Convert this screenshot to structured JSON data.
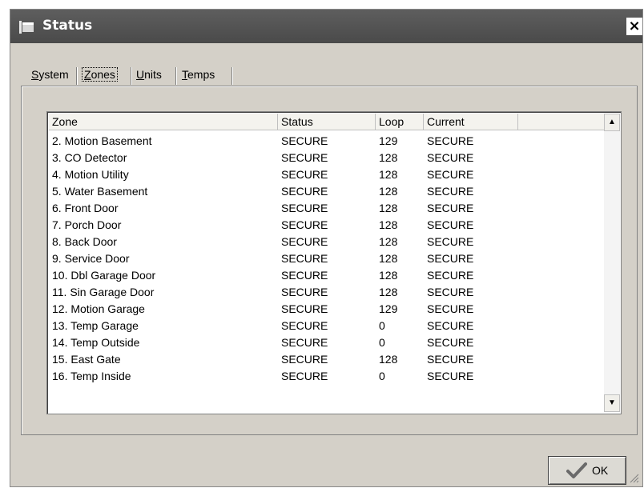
{
  "window": {
    "title": "Status",
    "close_label": "×"
  },
  "tabs": [
    {
      "label": "System",
      "underline": "S",
      "rest": "ystem"
    },
    {
      "label": "Zones",
      "underline": "Z",
      "rest": "ones"
    },
    {
      "label": "Units",
      "underline": "U",
      "rest": "nits"
    },
    {
      "label": "Temps",
      "underline": "T",
      "rest": "emps"
    }
  ],
  "active_tab": "Zones",
  "table": {
    "columns": [
      "Zone",
      "Status",
      "Loop",
      "Current"
    ],
    "rows": [
      [
        "2. Motion Basement",
        "SECURE",
        "129",
        "SECURE"
      ],
      [
        "3. CO Detector",
        "SECURE",
        "128",
        "SECURE"
      ],
      [
        "4. Motion Utility",
        "SECURE",
        "128",
        "SECURE"
      ],
      [
        "5. Water Basement",
        "SECURE",
        "128",
        "SECURE"
      ],
      [
        "6. Front Door",
        "SECURE",
        "128",
        "SECURE"
      ],
      [
        "7. Porch Door",
        "SECURE",
        "128",
        "SECURE"
      ],
      [
        "8. Back Door",
        "SECURE",
        "128",
        "SECURE"
      ],
      [
        "9. Service Door",
        "SECURE",
        "128",
        "SECURE"
      ],
      [
        "10. Dbl Garage Door",
        "SECURE",
        "128",
        "SECURE"
      ],
      [
        "11. Sin Garage Door",
        "SECURE",
        "128",
        "SECURE"
      ],
      [
        "12. Motion Garage",
        "SECURE",
        "129",
        "SECURE"
      ],
      [
        "13. Temp Garage",
        "SECURE",
        "0",
        "SECURE"
      ],
      [
        "14. Temp Outside",
        "SECURE",
        "0",
        "SECURE"
      ],
      [
        "15. East Gate",
        "SECURE",
        "128",
        "SECURE"
      ],
      [
        "16. Temp Inside",
        "SECURE",
        "0",
        "SECURE"
      ]
    ]
  },
  "scrollbar": {
    "up_arrow": "▲",
    "down_arrow": "▼"
  },
  "ok_button": {
    "label": "OK",
    "icon": "checkmark-icon"
  },
  "colors": {
    "titlebar": "#4f4f4f",
    "dialog_bg": "#d4d0c8"
  }
}
